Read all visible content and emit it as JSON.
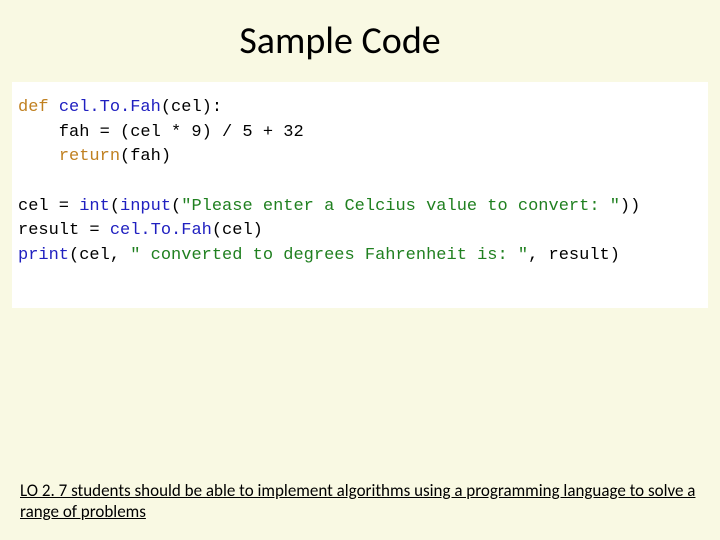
{
  "title": "Sample Code",
  "code": {
    "def": "def",
    "fn1": "cel.To.Fah",
    "l1_tail": "(cel):",
    "l2": "    fah = (cel * 9) / 5 + 32",
    "ret": "return",
    "l3_tail": "(fah)",
    "l5a": "cel = ",
    "int": "int",
    "l5b": "(",
    "input": "input",
    "l5c": "(",
    "str1": "\"Please enter a Celcius value to convert: \"",
    "l5d": "))",
    "l6a": "result = ",
    "fn2": "cel.To.Fah",
    "l6b": "(cel)",
    "print": "print",
    "l7a": "(cel, ",
    "str2": "\" converted to degrees Fahrenheit is: \"",
    "l7b": ", result)"
  },
  "footer": "LO 2. 7 students should be able to implement algorithms using a programming language to solve a range of problems"
}
